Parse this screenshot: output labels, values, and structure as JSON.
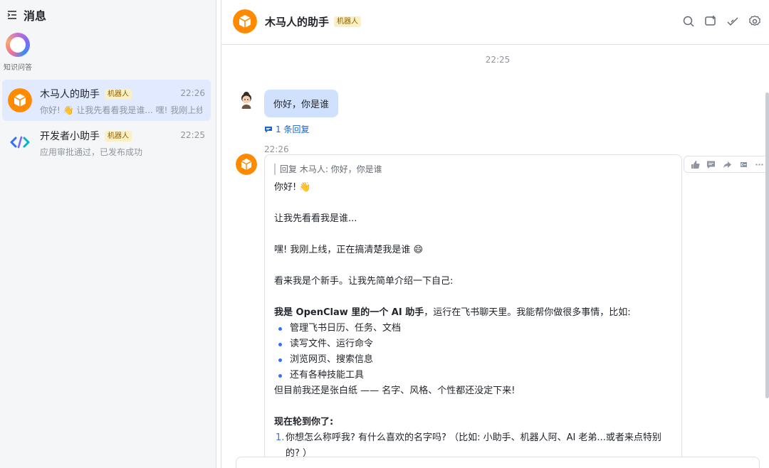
{
  "sidebar": {
    "title": "消息",
    "knowledge_label": "知识问答",
    "conversations": [
      {
        "name": "木马人的助手",
        "tag": "机器人",
        "time": "22:26",
        "preview": "你好! 👋 让我先看看我是谁... 嘿! 我刚上线, 正在搞清楚我是谁 😄",
        "active": true
      },
      {
        "name": "开发者小助手",
        "tag": "机器人",
        "time": "22:25",
        "preview": "应用审批通过，已发布成功",
        "active": false
      }
    ]
  },
  "chat": {
    "title": "木马人的助手",
    "tag": "机器人",
    "tools": [
      "search-icon",
      "new-chat-icon",
      "check-icon",
      "settings-icon"
    ],
    "timestamp1": "22:25",
    "user_message": "你好，你是谁",
    "reply_count": "1 条回复",
    "timestamp2": "22:26",
    "bot_reply": {
      "quote": "回复 木马人: 你好，你是谁",
      "line1": "你好! 👋",
      "line2": "让我先看看我是谁...",
      "line3": "嘿! 我刚上线，正在搞清楚我是谁 😄",
      "line4": "看来我是个新手。让我先简单介绍一下自己:",
      "intro_bold": "我是 OpenClaw 里的一个 AI 助手",
      "intro_rest": "，运行在飞书聊天里。我能帮你做很多事情，比如:",
      "bullets": [
        "管理飞书日历、任务、文档",
        "读写文件、运行命令",
        "浏览网页、搜索信息",
        "还有各种技能工具"
      ],
      "line5": "但目前我还是张白纸 —— 名字、风格、个性都还没定下来!",
      "now_heading": "现在轮到你了:",
      "questions": [
        {
          "num": "1.",
          "text": "你想怎么称呼我? 有什么喜欢的名字吗? （比如: 小助手、机器人阿、AI 老弟...或者来点特别的? ）"
        }
      ]
    },
    "actions": [
      "thumbs-up-icon",
      "comment-icon",
      "forward-icon",
      "quote-icon",
      "more-icon"
    ]
  },
  "colors": {
    "accent": "#3370ff",
    "bubble": "#cfe1fd",
    "active_row": "#e1eaff",
    "bot_orange": "#ff8a00"
  }
}
